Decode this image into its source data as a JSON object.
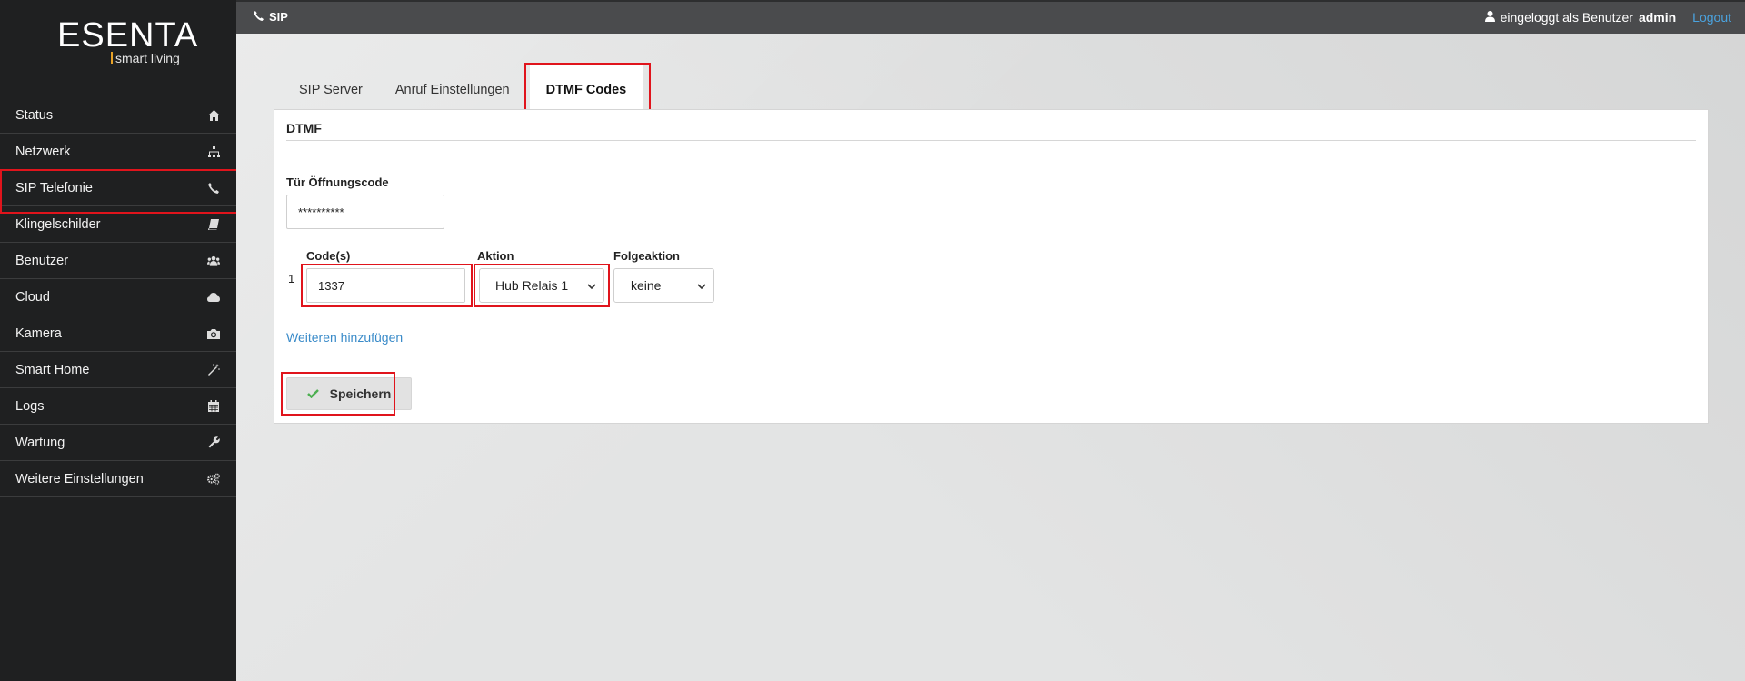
{
  "logo": {
    "main": "ESENTA",
    "sub": "smart living",
    "accent": "#e8a227"
  },
  "sidebar": {
    "items": [
      {
        "label": "Status",
        "icon": "home-icon"
      },
      {
        "label": "Netzwerk",
        "icon": "sitemap-icon"
      },
      {
        "label": "SIP Telefonie",
        "icon": "phone-icon",
        "active": true
      },
      {
        "label": "Klingelschilder",
        "icon": "book-icon"
      },
      {
        "label": "Benutzer",
        "icon": "users-icon"
      },
      {
        "label": "Cloud",
        "icon": "cloud-icon"
      },
      {
        "label": "Kamera",
        "icon": "camera-icon"
      },
      {
        "label": "Smart Home",
        "icon": "magic-wand-icon"
      },
      {
        "label": "Logs",
        "icon": "calendar-icon"
      },
      {
        "label": "Wartung",
        "icon": "wrench-icon"
      },
      {
        "label": "Weitere Einstellungen",
        "icon": "gears-icon"
      }
    ]
  },
  "header": {
    "title": "SIP",
    "user_prefix": "eingeloggt als Benutzer",
    "username": "admin",
    "logout": "Logout"
  },
  "tabs": [
    {
      "label": "SIP Server"
    },
    {
      "label": "Anruf Einstellungen"
    },
    {
      "label": "DTMF Codes",
      "active": true
    }
  ],
  "panel": {
    "title": "DTMF",
    "door_code_label": "Tür Öffnungscode",
    "door_code_value": "**********",
    "row_number": "1",
    "codes_label": "Code(s)",
    "code_value": "1337",
    "action_label": "Aktion",
    "action_value": "Hub Relais 1",
    "followup_label": "Folgeaktion",
    "followup_value": "keine",
    "add_more": "Weiteren hinzufügen",
    "save": "Speichern"
  },
  "colors": {
    "highlight": "#e0141c",
    "link": "#3a8bc9",
    "sidebar_bg": "#1f2021",
    "check": "#4caf50"
  }
}
